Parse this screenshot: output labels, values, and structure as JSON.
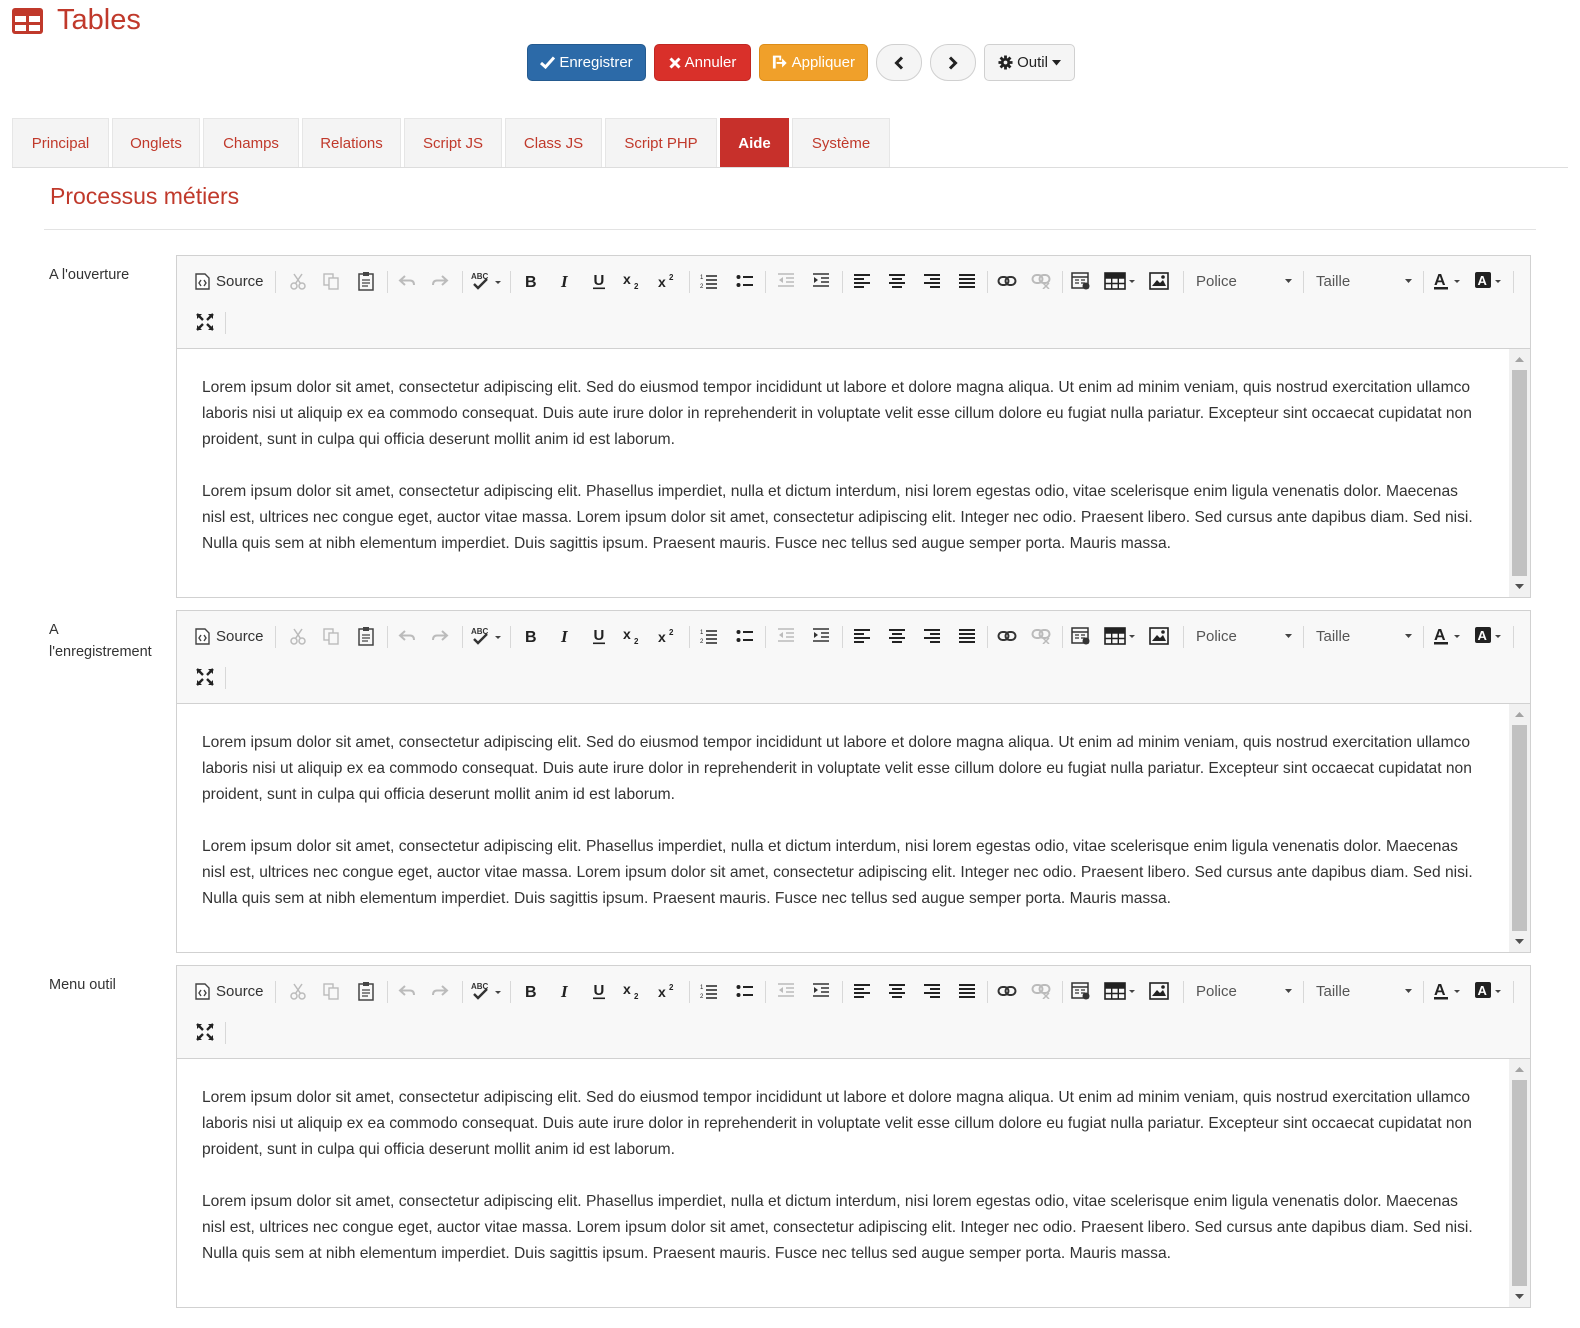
{
  "app": {
    "title": "Tables"
  },
  "actions": {
    "save": "Enregistrer",
    "cancel": "Annuler",
    "apply": "Appliquer",
    "tool": "Outil"
  },
  "tabs": [
    {
      "label": "Principal",
      "active": false
    },
    {
      "label": "Onglets",
      "active": false
    },
    {
      "label": "Champs",
      "active": false
    },
    {
      "label": "Relations",
      "active": false
    },
    {
      "label": "Script JS",
      "active": false
    },
    {
      "label": "Class JS",
      "active": false
    },
    {
      "label": "Script PHP",
      "active": false
    },
    {
      "label": "Aide",
      "active": true
    },
    {
      "label": "Système",
      "active": false
    }
  ],
  "section": {
    "title": "Processus métiers"
  },
  "toolbar": {
    "source": "Source",
    "font_placeholder": "Police",
    "size_placeholder": "Taille"
  },
  "fields": [
    {
      "label": "A l'ouverture",
      "paragraphs": [
        "Lorem ipsum dolor sit amet, consectetur adipiscing elit. Sed do eiusmod tempor incididunt ut labore et dolore magna aliqua. Ut enim ad minim veniam, quis nostrud exercitation ullamco laboris nisi ut aliquip ex ea commodo consequat. Duis aute irure dolor in reprehenderit in voluptate velit esse cillum dolore eu fugiat nulla pariatur. Excepteur sint occaecat cupidatat non proident, sunt in culpa qui officia deserunt mollit anim id est laborum.",
        "Lorem ipsum dolor sit amet, consectetur adipiscing elit. Phasellus imperdiet, nulla et dictum interdum, nisi lorem egestas odio, vitae scelerisque enim ligula venenatis dolor. Maecenas nisl est, ultrices nec congue eget, auctor vitae massa. Lorem ipsum dolor sit amet, consectetur adipiscing elit. Integer nec odio. Praesent libero. Sed cursus ante dapibus diam. Sed nisi. Nulla quis sem at nibh elementum imperdiet. Duis sagittis ipsum. Praesent mauris. Fusce nec tellus sed augue semper porta. Mauris massa."
      ]
    },
    {
      "label": "A l'enregistrement",
      "paragraphs": [
        "Lorem ipsum dolor sit amet, consectetur adipiscing elit. Sed do eiusmod tempor incididunt ut labore et dolore magna aliqua. Ut enim ad minim veniam, quis nostrud exercitation ullamco laboris nisi ut aliquip ex ea commodo consequat. Duis aute irure dolor in reprehenderit in voluptate velit esse cillum dolore eu fugiat nulla pariatur. Excepteur sint occaecat cupidatat non proident, sunt in culpa qui officia deserunt mollit anim id est laborum.",
        "Lorem ipsum dolor sit amet, consectetur adipiscing elit. Phasellus imperdiet, nulla et dictum interdum, nisi lorem egestas odio, vitae scelerisque enim ligula venenatis dolor. Maecenas nisl est, ultrices nec congue eget, auctor vitae massa. Lorem ipsum dolor sit amet, consectetur adipiscing elit. Integer nec odio. Praesent libero. Sed cursus ante dapibus diam. Sed nisi. Nulla quis sem at nibh elementum imperdiet. Duis sagittis ipsum. Praesent mauris. Fusce nec tellus sed augue semper porta. Mauris massa."
      ]
    },
    {
      "label": "Menu outil",
      "paragraphs": [
        "Lorem ipsum dolor sit amet, consectetur adipiscing elit. Sed do eiusmod tempor incididunt ut labore et dolore magna aliqua. Ut enim ad minim veniam, quis nostrud exercitation ullamco laboris nisi ut aliquip ex ea commodo consequat. Duis aute irure dolor in reprehenderit in voluptate velit esse cillum dolore eu fugiat nulla pariatur. Excepteur sint occaecat cupidatat non proident, sunt in culpa qui officia deserunt mollit anim id est laborum.",
        "Lorem ipsum dolor sit amet, consectetur adipiscing elit. Phasellus imperdiet, nulla et dictum interdum, nisi lorem egestas odio, vitae scelerisque enim ligula venenatis dolor. Maecenas nisl est, ultrices nec congue eget, auctor vitae massa. Lorem ipsum dolor sit amet, consectetur adipiscing elit. Integer nec odio. Praesent libero. Sed cursus ante dapibus diam. Sed nisi. Nulla quis sem at nibh elementum imperdiet. Duis sagittis ipsum. Praesent mauris. Fusce nec tellus sed augue semper porta. Mauris massa."
      ]
    }
  ],
  "colors": {
    "accent": "#c0392b",
    "save": "#2c6aa8",
    "cancel": "#d9302a",
    "apply": "#f0a02a"
  }
}
